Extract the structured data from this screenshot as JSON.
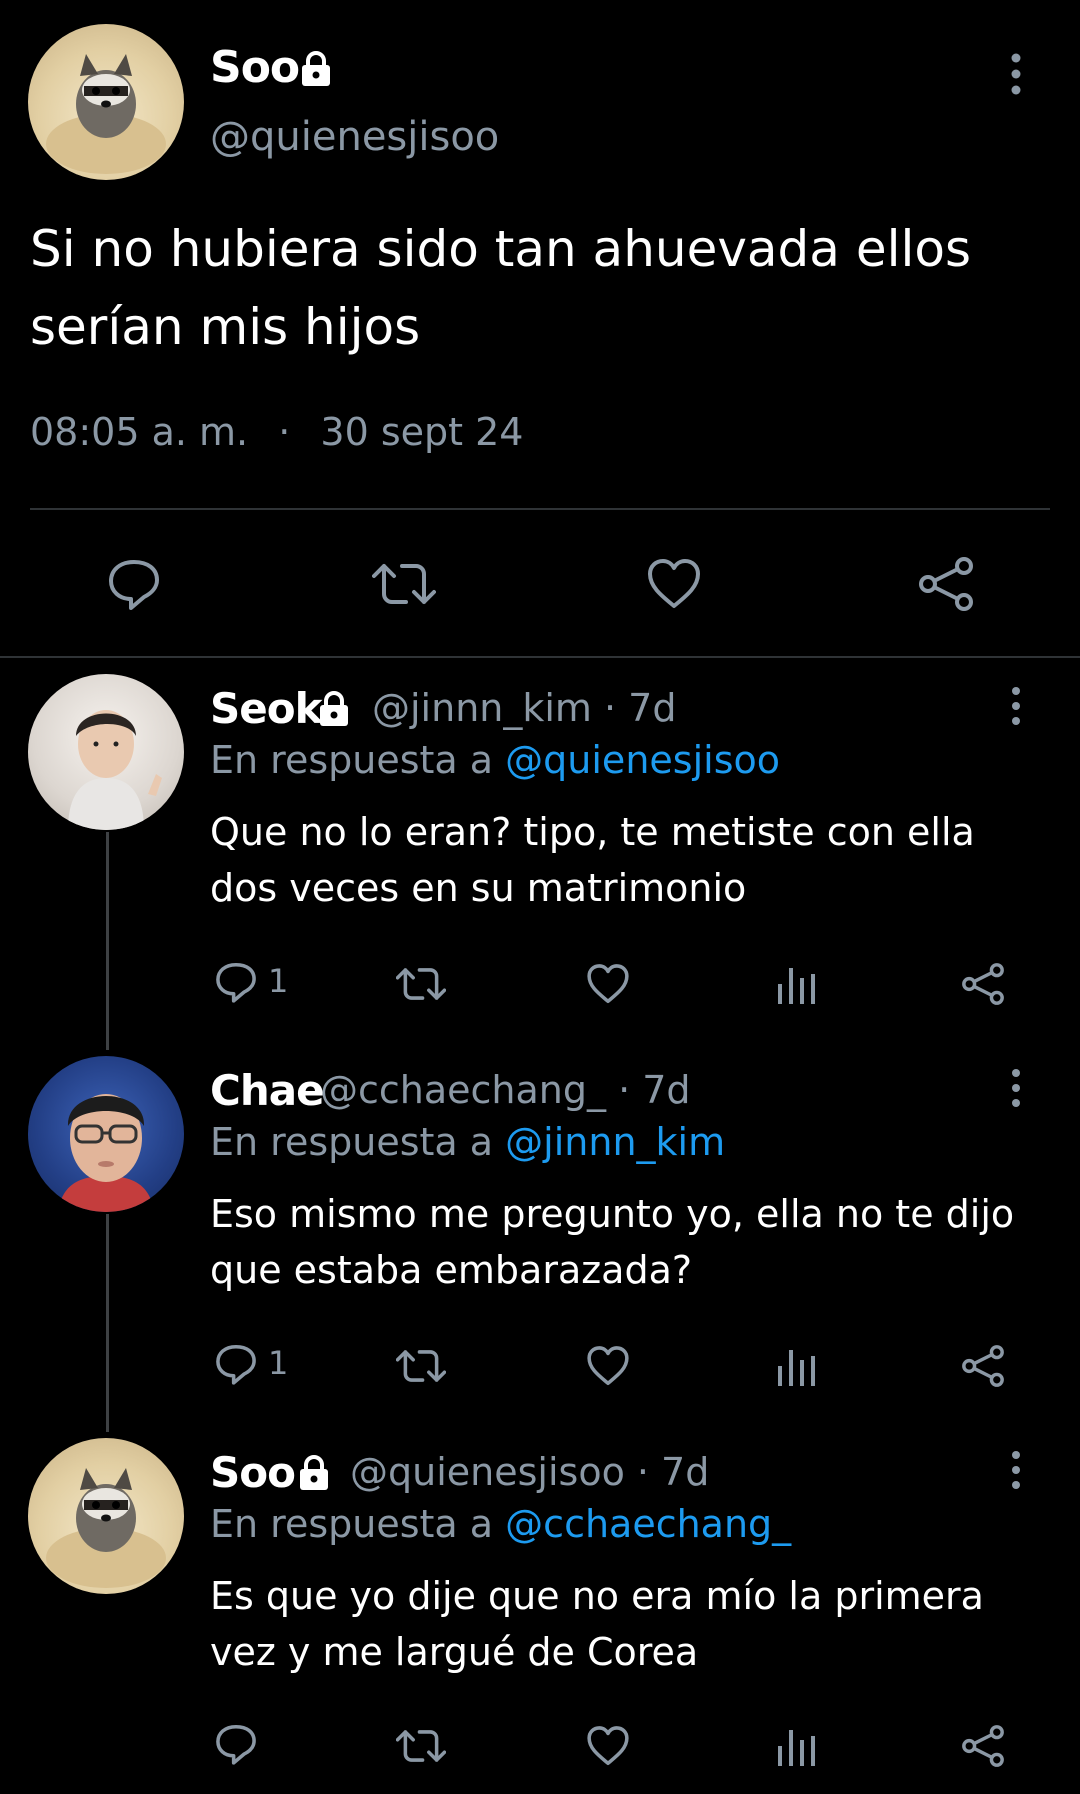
{
  "main_tweet": {
    "name": "Soo",
    "handle": "@quienesjisoo",
    "text_line1": "Si no hubiera sido tan ahuevada ellos",
    "text_line2": "serían mis hijos",
    "time": "08:05 a. m.",
    "separator": "·",
    "date": "30 sept 24",
    "icons": [
      "reply-icon",
      "retweet-icon",
      "like-icon",
      "share-icon"
    ]
  },
  "replies": [
    {
      "name": "Seok",
      "handle_time": "@jinnn_kim · 7d",
      "reply_prefix": "En respuesta a",
      "reply_mention": "@quienesjisoo",
      "text_line1": "Que no lo eran? tipo, te metiste con ella",
      "text_line2": "dos veces en su matrimonio",
      "reply_count": "1"
    },
    {
      "name": "Chae",
      "handle_time": "@cchaechang_ · 7d",
      "reply_prefix": "En respuesta a",
      "reply_mention": "@jinnn_kim",
      "text_line1": "Eso mismo me pregunto yo, ella no te dijo",
      "text_line2": "que estaba embarazada?",
      "reply_count": "1"
    },
    {
      "name": "Soo",
      "handle_time": "@quienesjisoo · 7d",
      "reply_prefix": "En respuesta a",
      "reply_mention": "@cchaechang_",
      "text_line1": "Es que yo dije que no era mío la primera",
      "text_line2": "vez y me largué de Corea",
      "reply_count": ""
    }
  ],
  "colors": {
    "background": "#000000",
    "text": "#ffffff",
    "muted": "#8b98a5",
    "link": "#1d9bf0",
    "divider": "#2f3336"
  }
}
